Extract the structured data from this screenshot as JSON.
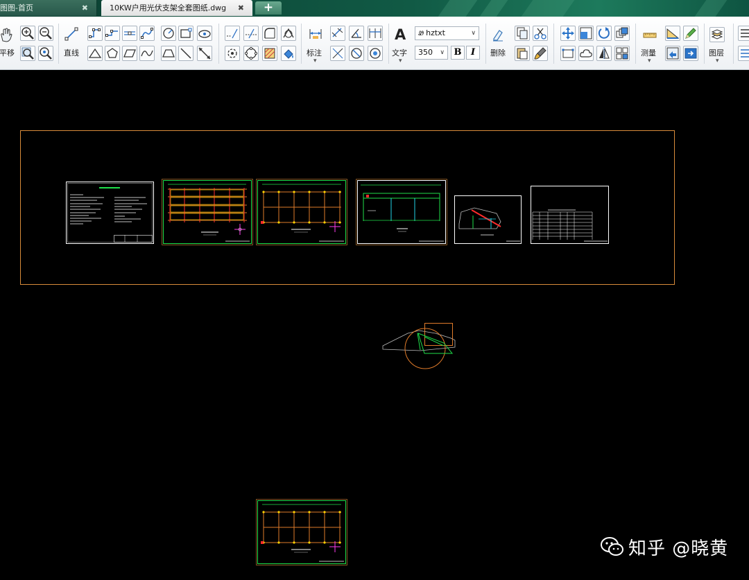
{
  "tabs": [
    {
      "label": "图图-首页",
      "active": false
    },
    {
      "label": "10KW户用光伏支架全套图纸.dwg",
      "active": true
    }
  ],
  "tab_close_glyph": "✖",
  "new_tab_glyph": "+",
  "ribbon": {
    "pan_label": "平移",
    "line_label": "直线",
    "dim_label": "标注",
    "text_label": "文字",
    "text_glyph": "A",
    "font_value": "hztxt",
    "size_value": "350",
    "bold": "B",
    "italic": "I",
    "delete_label": "删除",
    "measure_label": "测量",
    "layer_label": "图层",
    "dropdown_glyph": "▾"
  },
  "colors": {
    "canvas_bg": "#000000",
    "frame_border": "#d98c3a",
    "drawing_green": "#1fe04a",
    "drawing_orange": "#e07b2a",
    "drawing_red": "#ff2b2b",
    "drawing_yellow": "#ffd400",
    "drawing_cyan": "#22d4e8",
    "drawing_magenta": "#ff3cf0"
  },
  "icons": [
    "pan-icon",
    "zoom-in-icon",
    "zoom-out-icon",
    "zoom-window-icon",
    "zoom-extents-icon",
    "line-icon",
    "arc-icon",
    "rectangle-icon",
    "circle-icon",
    "polygon-icon",
    "text-icon",
    "delete-icon",
    "copy-icon",
    "cut-icon",
    "move-icon",
    "rotate-icon",
    "mirror-icon",
    "measure-icon",
    "layer-icon",
    "wechat-icon"
  ],
  "watermark": "知乎 @晓黄"
}
